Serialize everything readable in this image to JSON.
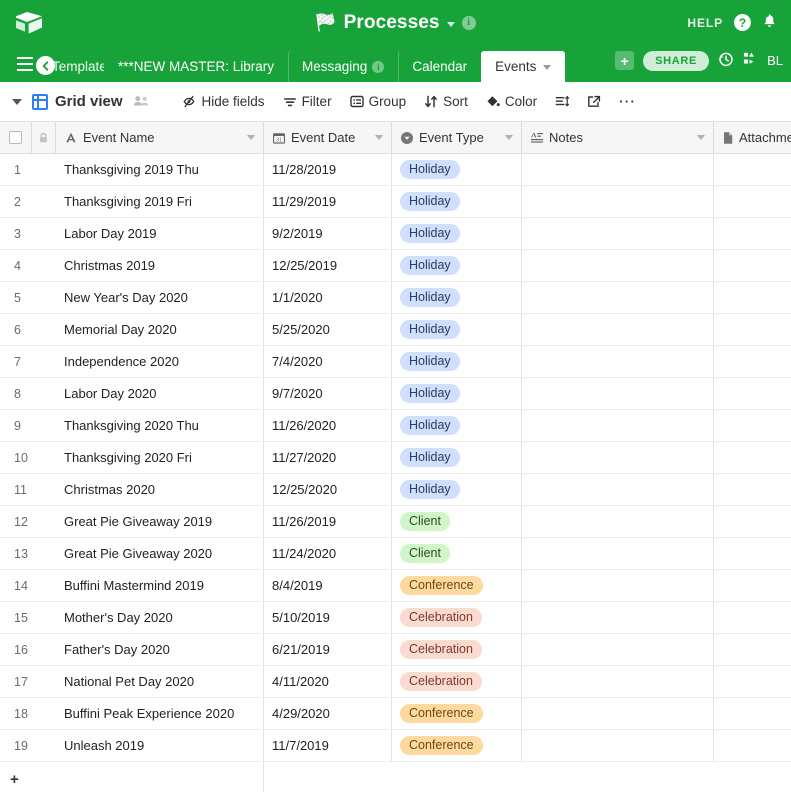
{
  "topbar": {
    "logo_icon": "airtable-logo-icon",
    "flag_icon": "checkered-flag-icon",
    "app_title": "Processes",
    "title_caret_icon": "chevron-down-icon",
    "info_icon": "info-icon",
    "info_glyph": "i",
    "help_label": "HELP",
    "help_icon": "question-mark-icon",
    "help_glyph": "?",
    "bell_icon": "bell-notification-icon",
    "bell_glyph": "🔔",
    "brand_color": "#18a33a"
  },
  "tabbar": {
    "menu_icon": "hamburger-menu-icon",
    "scroll_left_icon": "chevron-left-icon",
    "scroll_left_glyph": "◀",
    "tabs": [
      {
        "label": "Templates",
        "clipped": true,
        "active": false,
        "has_info": false,
        "has_caret": false
      },
      {
        "label": "***NEW MASTER: Library",
        "clipped": false,
        "active": false,
        "has_info": false,
        "has_caret": false
      },
      {
        "label": "Messaging",
        "clipped": false,
        "active": false,
        "has_info": true,
        "has_caret": false
      },
      {
        "label": "Calendar",
        "clipped": false,
        "active": false,
        "has_info": false,
        "has_caret": false
      },
      {
        "label": "Events",
        "clipped": false,
        "active": true,
        "has_info": false,
        "has_caret": true
      }
    ],
    "add_table_icon": "plus-icon",
    "add_table_glyph": "+",
    "share_label": "SHARE",
    "history_icon": "history-clock-icon",
    "history_glyph": "↺",
    "blocks_icon": "blocks-icon",
    "blocks_label": "BL"
  },
  "toolbar": {
    "view_caret_icon": "chevron-down-icon",
    "grid_icon": "grid-view-icon",
    "view_name": "Grid view",
    "collaborators_icon": "collaborators-icon",
    "collaborators_glyph": "👥",
    "items": [
      {
        "label": "Hide fields",
        "icon": "eye-slash-icon",
        "glyph": "⌀"
      },
      {
        "label": "Filter",
        "icon": "funnel-icon",
        "glyph": "☰"
      },
      {
        "label": "Group",
        "icon": "group-icon",
        "glyph": "▤"
      },
      {
        "label": "Sort",
        "icon": "sort-arrows-icon",
        "glyph": "⇅"
      },
      {
        "label": "Color",
        "icon": "paint-drop-icon",
        "glyph": "◆"
      }
    ],
    "row_height_icon": "row-height-icon",
    "row_height_glyph": "≡",
    "share_view_icon": "share-external-link-icon",
    "share_view_glyph": "↗",
    "more_icon": "more-options-icon",
    "more_glyph": "⋯"
  },
  "grid": {
    "select_all_icon": "select-all-checkbox",
    "lock_icon": "lock-icon",
    "lock_glyph": "🔒",
    "columns": [
      {
        "name": "Event Name",
        "icon": "text-field-icon",
        "glyph": "A",
        "has_caret": true
      },
      {
        "name": "Event Date",
        "icon": "calendar-icon",
        "glyph": "31",
        "has_caret": true
      },
      {
        "name": "Event Type",
        "icon": "single-select-icon",
        "glyph": "▼",
        "has_caret": true
      },
      {
        "name": "Notes",
        "icon": "long-text-icon",
        "glyph": "≡",
        "has_caret": true
      },
      {
        "name": "Attachments",
        "icon": "attachment-file-icon",
        "glyph": "▮",
        "has_caret": false
      }
    ],
    "tag_colors": {
      "Holiday": {
        "bg": "#cfdffc",
        "fg": "#2b3a67"
      },
      "Client": {
        "bg": "#d0f5c8",
        "fg": "#2e4a28"
      },
      "Conference": {
        "bg": "#ffd9a0",
        "fg": "#6b4a10"
      },
      "Celebration": {
        "bg": "#fadbd0",
        "fg": "#7a3b28"
      }
    },
    "rows": [
      {
        "num": "1",
        "name": "Thanksgiving 2019 Thu",
        "date": "11/28/2019",
        "type": "Holiday",
        "notes": "",
        "attachments": ""
      },
      {
        "num": "2",
        "name": "Thanksgiving 2019 Fri",
        "date": "11/29/2019",
        "type": "Holiday",
        "notes": "",
        "attachments": ""
      },
      {
        "num": "3",
        "name": "Labor Day 2019",
        "date": "9/2/2019",
        "type": "Holiday",
        "notes": "",
        "attachments": ""
      },
      {
        "num": "4",
        "name": "Christmas 2019",
        "date": "12/25/2019",
        "type": "Holiday",
        "notes": "",
        "attachments": ""
      },
      {
        "num": "5",
        "name": "New Year's Day 2020",
        "date": "1/1/2020",
        "type": "Holiday",
        "notes": "",
        "attachments": ""
      },
      {
        "num": "6",
        "name": "Memorial Day 2020",
        "date": "5/25/2020",
        "type": "Holiday",
        "notes": "",
        "attachments": ""
      },
      {
        "num": "7",
        "name": "Independence 2020",
        "date": "7/4/2020",
        "type": "Holiday",
        "notes": "",
        "attachments": ""
      },
      {
        "num": "8",
        "name": "Labor Day 2020",
        "date": "9/7/2020",
        "type": "Holiday",
        "notes": "",
        "attachments": ""
      },
      {
        "num": "9",
        "name": "Thanksgiving 2020 Thu",
        "date": "11/26/2020",
        "type": "Holiday",
        "notes": "",
        "attachments": ""
      },
      {
        "num": "10",
        "name": "Thanksgiving 2020 Fri",
        "date": "11/27/2020",
        "type": "Holiday",
        "notes": "",
        "attachments": ""
      },
      {
        "num": "11",
        "name": "Christmas 2020",
        "date": "12/25/2020",
        "type": "Holiday",
        "notes": "",
        "attachments": ""
      },
      {
        "num": "12",
        "name": "Great Pie Giveaway 2019",
        "date": "11/26/2019",
        "type": "Client",
        "notes": "",
        "attachments": ""
      },
      {
        "num": "13",
        "name": "Great Pie Giveaway 2020",
        "date": "11/24/2020",
        "type": "Client",
        "notes": "",
        "attachments": ""
      },
      {
        "num": "14",
        "name": "Buffini Mastermind 2019",
        "date": "8/4/2019",
        "type": "Conference",
        "notes": "",
        "attachments": ""
      },
      {
        "num": "15",
        "name": "Mother's Day 2020",
        "date": "5/10/2019",
        "type": "Celebration",
        "notes": "",
        "attachments": ""
      },
      {
        "num": "16",
        "name": "Father's Day 2020",
        "date": "6/21/2019",
        "type": "Celebration",
        "notes": "",
        "attachments": ""
      },
      {
        "num": "17",
        "name": "National Pet Day 2020",
        "date": "4/11/2020",
        "type": "Celebration",
        "notes": "",
        "attachments": ""
      },
      {
        "num": "18",
        "name": "Buffini Peak Experience 2020",
        "date": "4/29/2020",
        "type": "Conference",
        "notes": "",
        "attachments": ""
      },
      {
        "num": "19",
        "name": "Unleash 2019",
        "date": "11/7/2019",
        "type": "Conference",
        "notes": "",
        "attachments": ""
      }
    ],
    "add_row_icon": "add-row-icon",
    "add_row_glyph": "+"
  }
}
